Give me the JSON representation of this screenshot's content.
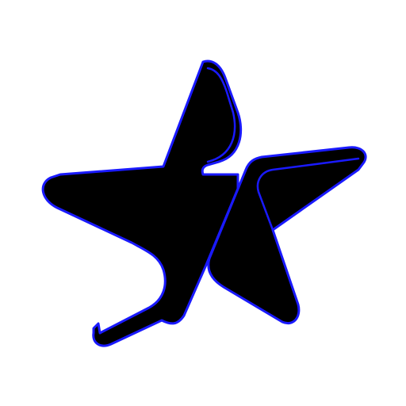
{
  "icon": {
    "name": "split-star-icon",
    "fill_color": "#000000",
    "stroke_color": "#1a1aff",
    "background_color": "#ffffff"
  }
}
